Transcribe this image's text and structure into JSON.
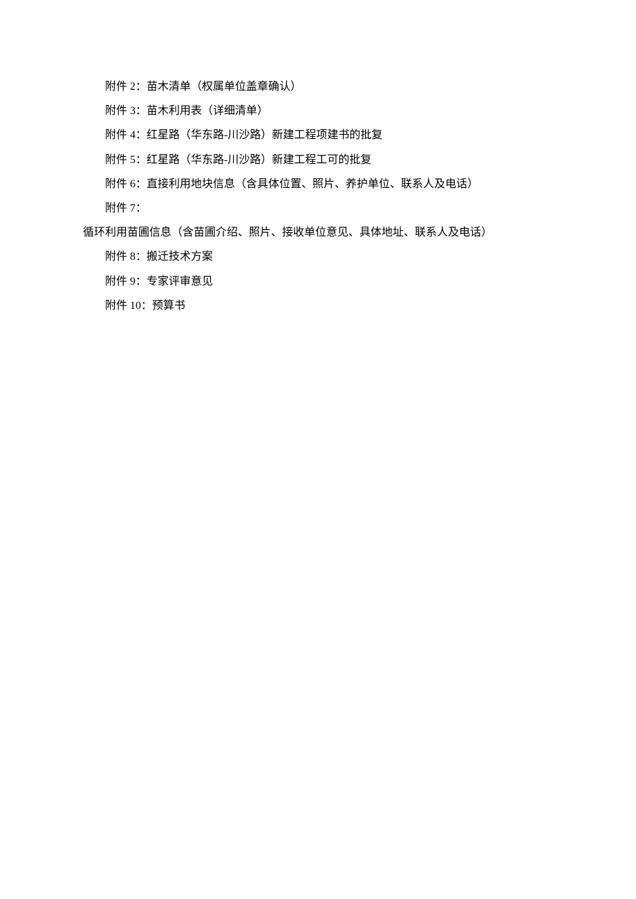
{
  "attachments": [
    {
      "label": "附件 2：",
      "text": "苗木清单（权属单位盖章确认）"
    },
    {
      "label": "附件 3：",
      "text": "苗木利用表（详细清单）"
    },
    {
      "label": "附件 4：",
      "text": "红星路（华东路-川沙路）新建工程项建书的批复"
    },
    {
      "label": "附件 5：",
      "text": "红星路（华东路-川沙路）新建工程工可的批复"
    },
    {
      "label": "附件 6：",
      "text": "直接利用地块信息（含具体位置、照片、养护单位、联系人及电话）"
    },
    {
      "label": "附件 7：",
      "text": "循环利用苗圃信息（含苗圃介绍、照片、接收单位意见、具体地址、联系人及电话）"
    },
    {
      "label": "附件 8：",
      "text": "搬迁技术方案"
    },
    {
      "label": "附件 9：",
      "text": "专家评审意见"
    },
    {
      "label": "附件 10：",
      "text": "预算书"
    }
  ]
}
